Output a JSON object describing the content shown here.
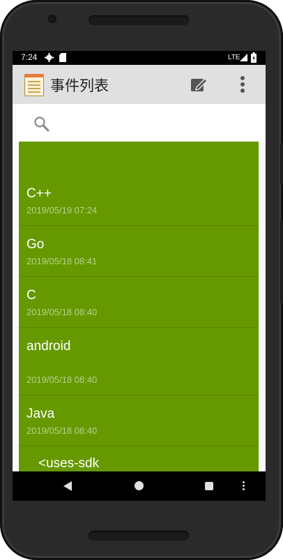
{
  "status_bar": {
    "time": "7:24",
    "left_icons": [
      "settings-gear-icon",
      "sd-card-icon"
    ],
    "network": "LTE",
    "right_icons": [
      "signal-icon",
      "battery-icon"
    ]
  },
  "app_bar": {
    "title": "事件列表",
    "actions": [
      "edit-icon",
      "more-vert-icon"
    ]
  },
  "search": {
    "icon": "search-icon"
  },
  "events": [
    {
      "name": "C++",
      "date": "2019/05/19 07:24"
    },
    {
      "name": "Go",
      "date": "2019/05/18 08:41"
    },
    {
      "name": "C",
      "date": "2019/05/18 08:40"
    },
    {
      "name": "android",
      "date": "2019/05/18 08:40"
    },
    {
      "name": "Java",
      "date": "2019/05/18 08:40"
    },
    {
      "name": "<uses-sdk",
      "date": ""
    }
  ],
  "nav_bar": {
    "buttons": [
      "back-icon",
      "home-icon",
      "recents-icon",
      "more-icon"
    ]
  },
  "colors": {
    "list_background": "#669900",
    "item_text": "#ffffff",
    "date_text": "#b5d38c",
    "app_bar": "#e0e0e0"
  }
}
